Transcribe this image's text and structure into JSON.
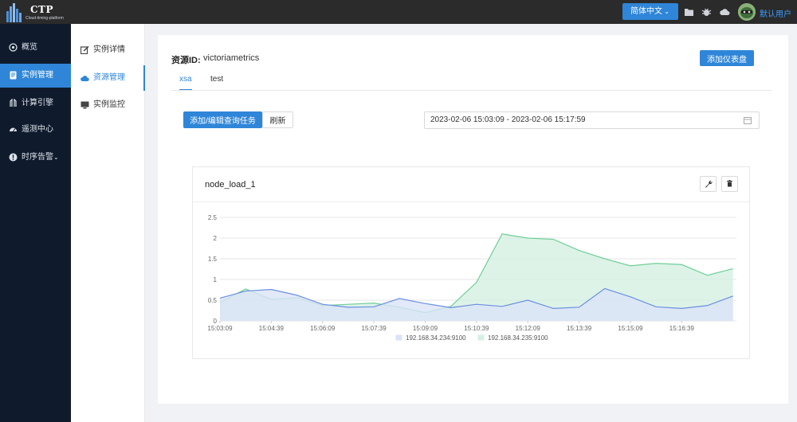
{
  "app": {
    "logo_title": "CTP",
    "logo_subtitle": "Cloud-timing-platform",
    "language": "简体中文",
    "username": "默认用户",
    "accent_color": "#2f86d8"
  },
  "sidebar": {
    "items": [
      {
        "label": "概览",
        "icon": "dashboard-icon"
      },
      {
        "label": "实例管理",
        "icon": "instance-icon",
        "active": true
      },
      {
        "label": "计算引擎",
        "icon": "engine-icon"
      },
      {
        "label": "遥测中心",
        "icon": "telemetry-icon"
      },
      {
        "label": "时序告警",
        "icon": "alert-icon",
        "has_submenu": true
      }
    ]
  },
  "subnav": {
    "items": [
      {
        "label": "实例详情",
        "icon": "edit-icon"
      },
      {
        "label": "资源管理",
        "icon": "cloud-icon",
        "active": true
      },
      {
        "label": "实例监控",
        "icon": "monitor-icon"
      }
    ]
  },
  "main": {
    "resource_label": "资源ID:",
    "resource_id": "victoriametrics",
    "add_dashboard": "添加仪表盘",
    "tabs": [
      {
        "label": "xsa",
        "active": true
      },
      {
        "label": "test"
      }
    ],
    "add_query": "添加/编辑查询任务",
    "refresh": "刷新",
    "time_range": "2023-02-06 15:03:09 - 2023-02-06 15:17:59"
  },
  "panel": {
    "title": "node_load_1",
    "tools": [
      "wrench-icon",
      "trash-icon"
    ]
  },
  "chart_data": {
    "type": "area",
    "ylim": [
      0,
      2.5
    ],
    "yticks": [
      "0",
      "0.5",
      "1",
      "1.5",
      "2",
      "2.5"
    ],
    "x_tick_labels": [
      "15:03:09",
      "15:04:39",
      "15:06:09",
      "15:07:39",
      "15:09:09",
      "15:10:39",
      "15:12:09",
      "15:13:39",
      "15:15:09",
      "15:16:39"
    ],
    "x_range_minutes": [
      0,
      14.5
    ],
    "grid": true,
    "legend": "bottom",
    "series": [
      {
        "name": "192.168.34.234:9100",
        "color": "#6b8fe0",
        "fill": "#dbe3f8",
        "x": [
          0,
          0.75,
          1.5,
          2.25,
          3,
          3.75,
          4.5,
          5.25,
          6,
          6.75,
          7.5,
          8.25,
          9,
          9.75,
          10.5,
          11.25,
          12,
          12.75,
          13.5,
          14.25,
          15
        ],
        "y": [
          0.55,
          0.72,
          0.76,
          0.62,
          0.4,
          0.33,
          0.34,
          0.54,
          0.42,
          0.32,
          0.4,
          0.35,
          0.5,
          0.3,
          0.33,
          0.78,
          0.58,
          0.34,
          0.3,
          0.37,
          0.6
        ]
      },
      {
        "name": "192.168.34.235:9100",
        "color": "#6fcf97",
        "fill": "#d5f0e2",
        "x": [
          0,
          0.75,
          1.5,
          2.25,
          3,
          3.75,
          4.5,
          5.25,
          6,
          6.75,
          7.5,
          8.25,
          9,
          9.75,
          10.5,
          11.25,
          12,
          12.75,
          13.5,
          14.25,
          15
        ],
        "y": [
          0.44,
          0.77,
          0.52,
          0.56,
          0.37,
          0.4,
          0.43,
          0.33,
          0.2,
          0.35,
          0.93,
          2.1,
          2.0,
          1.97,
          1.7,
          1.5,
          1.33,
          1.39,
          1.36,
          1.1,
          1.26
        ]
      }
    ]
  }
}
